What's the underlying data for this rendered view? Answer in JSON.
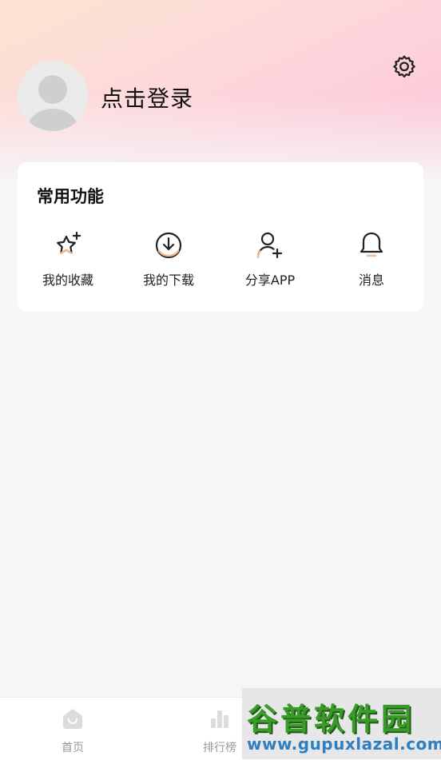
{
  "profile": {
    "login_text": "点击登录",
    "avatar_icon": "default-avatar-icon",
    "settings_icon": "gear-icon"
  },
  "functions": {
    "title": "常用功能",
    "items": [
      {
        "label": "我的收藏",
        "icon": "star-sparkle-icon"
      },
      {
        "label": "我的下载",
        "icon": "download-circle-icon"
      },
      {
        "label": "分享APP",
        "icon": "user-add-icon"
      },
      {
        "label": "消息",
        "icon": "bell-icon"
      }
    ]
  },
  "tabbar": {
    "items": [
      {
        "label": "首页",
        "icon": "home-icon"
      },
      {
        "label": "排行榜",
        "icon": "bar-chart-icon"
      }
    ]
  },
  "watermark": {
    "title": "谷普软件园",
    "url": "www.gupuxlazal.com"
  },
  "colors": {
    "accent": "#f5b98a",
    "hero_start": "#fde4d0",
    "hero_end": "#fcc4d8"
  }
}
